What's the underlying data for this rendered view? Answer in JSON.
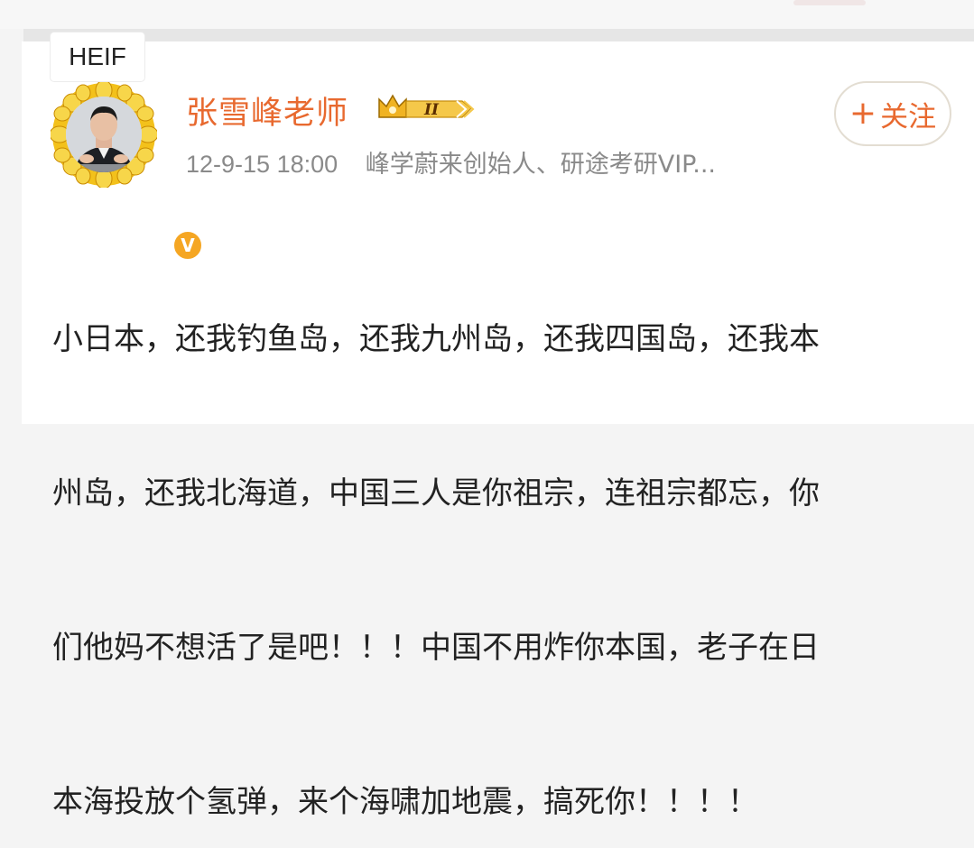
{
  "overlay": {
    "badge": "HEIF"
  },
  "post": {
    "author": "张雪峰老师",
    "vip_level": "II",
    "timestamp": "12-9-15 18:00",
    "author_description": "峰学蔚来创始人、研途考研VIP...",
    "follow_label": "关注",
    "follow_icon": "plus-icon",
    "verified_icon": "verified-v-icon",
    "content_lines": [
      "小日本，还我钓鱼岛，还我九州岛，还我四国岛，还我本",
      "州岛，还我北海道，中国三人是你祖宗，连祖宗都忘，你",
      "们他妈不想活了是吧！！！中国不用炸你本国，老子在日",
      "本海投放个氢弹，来个海啸加地震，搞死你！！！！"
    ]
  },
  "colors": {
    "accent": "#e8692f",
    "meta_text": "#8a8a8a",
    "verified": "#f5a623"
  }
}
